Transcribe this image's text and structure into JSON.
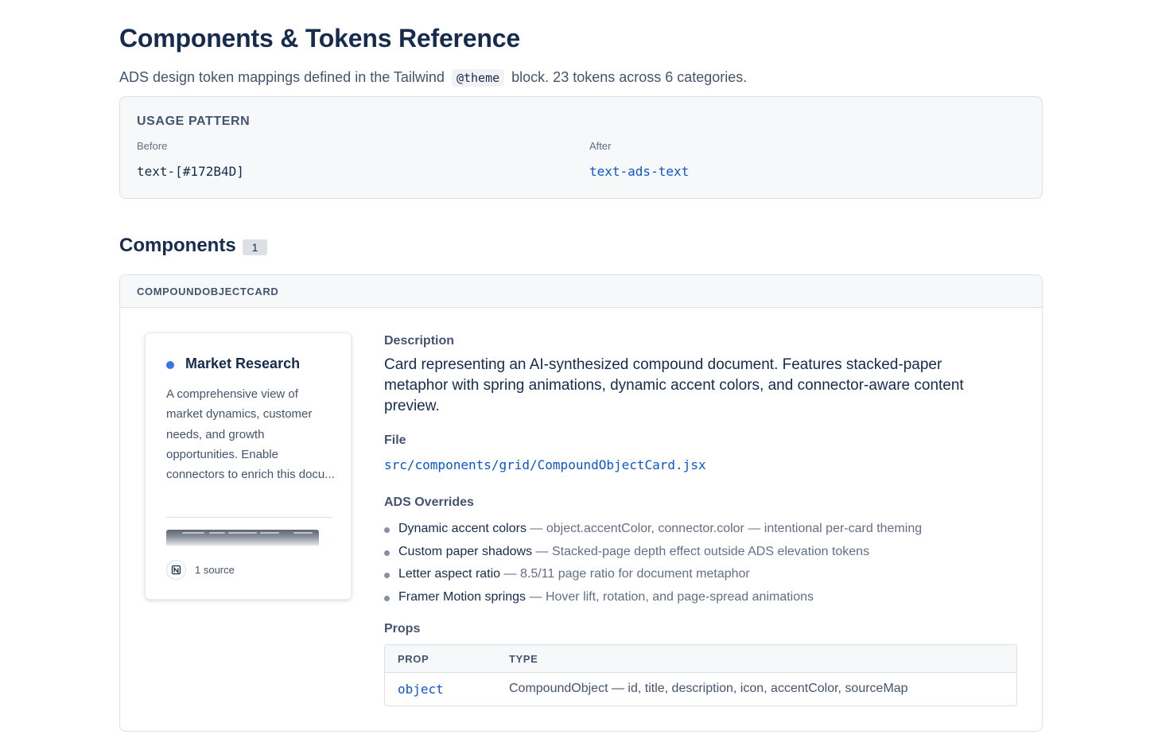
{
  "page": {
    "title": "Components & Tokens Reference",
    "subtitle_before": "ADS design token mappings defined in the Tailwind",
    "subtitle_code": "@theme",
    "subtitle_after": "block. 23 tokens across 6 categories."
  },
  "usage_pattern": {
    "title": "USAGE PATTERN",
    "before_label": "Before",
    "before_code": "text-[#172B4D]",
    "after_label": "After",
    "after_code": "text-ads-text"
  },
  "components_section": {
    "title": "Components",
    "count": "1"
  },
  "component": {
    "name": "COMPOUNDOBJECTCARD",
    "preview": {
      "title": "Market Research",
      "accent_color": "#3B73E5",
      "description": "A comprehensive view of market dynamics, customer needs, and growth opportunities. Enable connectors to enrich this docu...",
      "source_count": "1 source",
      "source_icon": "notion-icon"
    },
    "description_label": "Description",
    "description": "Card representing an AI-synthesized compound document. Features stacked-paper metaphor with spring animations, dynamic accent colors, and connector-aware content preview.",
    "file_label": "File",
    "file_path": "src/components/grid/CompoundObjectCard.jsx",
    "overrides_label": "ADS Overrides",
    "overrides": [
      {
        "name": "Dynamic accent colors",
        "detail": "— object.accentColor, connector.color — intentional per-card theming"
      },
      {
        "name": "Custom paper shadows",
        "detail": "— Stacked-page depth effect outside ADS elevation tokens"
      },
      {
        "name": "Letter aspect ratio",
        "detail": "— 8.5/11 page ratio for document metaphor"
      },
      {
        "name": "Framer Motion springs",
        "detail": "— Hover lift, rotation, and page-spread animations"
      }
    ],
    "props_label": "Props",
    "props_table": {
      "headers": [
        "PROP",
        "TYPE"
      ],
      "rows": [
        {
          "prop": "object",
          "type": "CompoundObject — id, title, description, icon, accentColor, sourceMap"
        }
      ]
    }
  },
  "colors": {
    "text_primary": "#172B4D",
    "text_subtle": "#44546F",
    "link_blue": "#0C55CF",
    "accent_dot": "#3B73E5",
    "border": "#DCDFE4",
    "surface_sunken": "#F7F8F9"
  }
}
